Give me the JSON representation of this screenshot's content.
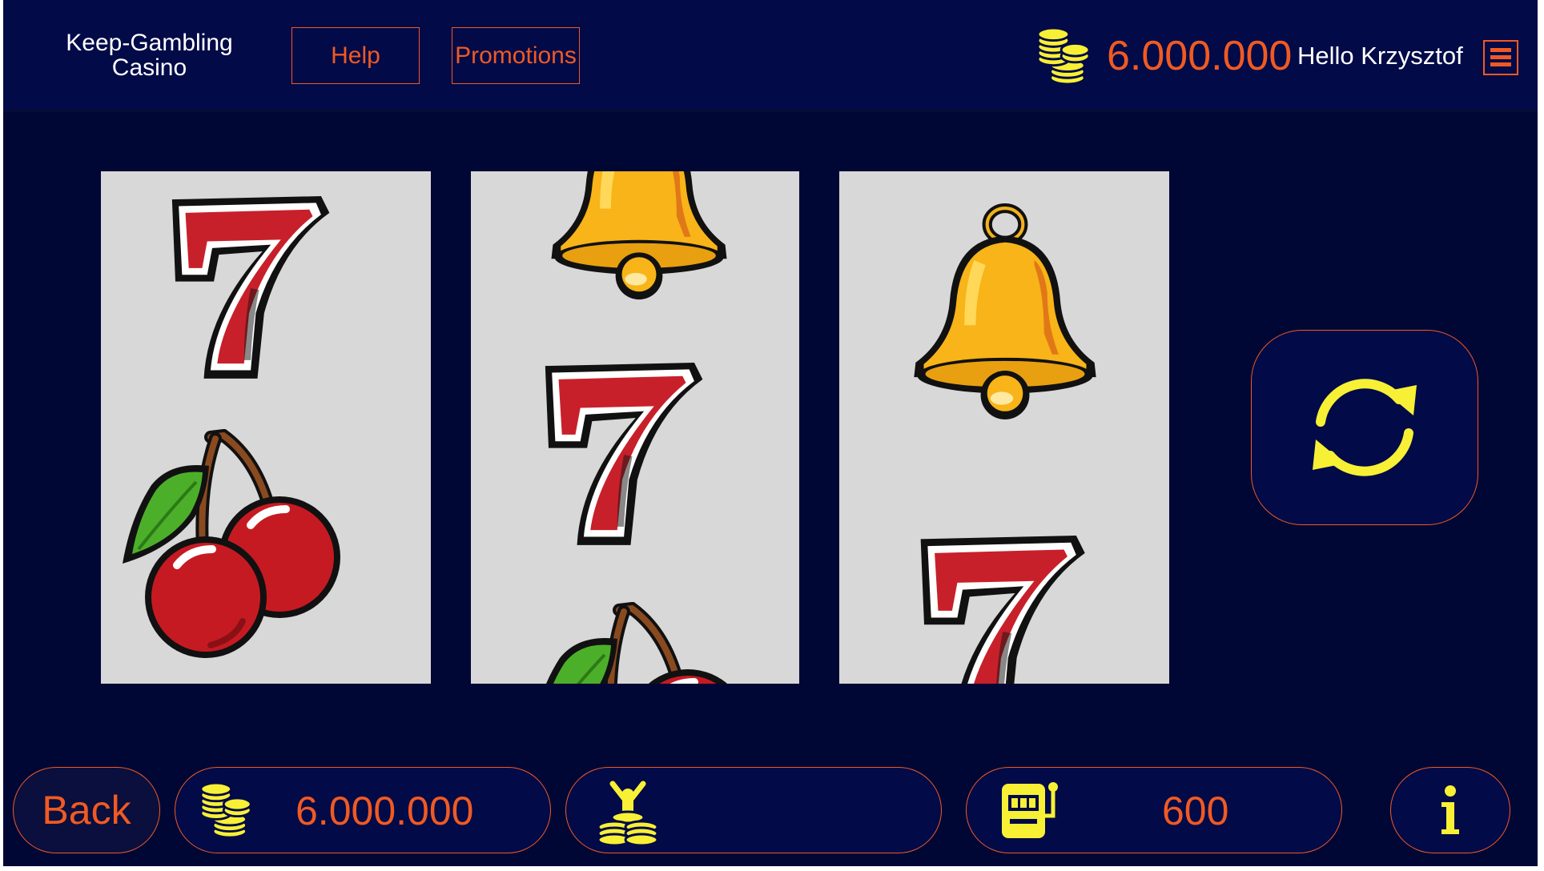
{
  "header": {
    "logo": "Keep-Gambling\nCasino",
    "logo_line1": "Keep-Gambling",
    "logo_line2": "Casino",
    "help_label": "Help",
    "promotions_label": "Promotions",
    "balance": "6.000.000",
    "greeting": "Hello Krzysztof",
    "coin_icon": "coin-stack-icon",
    "menu_icon": "hamburger-menu-icon"
  },
  "reels": [
    {
      "name": "reel-1",
      "symbols": [
        "seven",
        "cherry"
      ]
    },
    {
      "name": "reel-2",
      "symbols": [
        "bell",
        "seven",
        "cherry"
      ]
    },
    {
      "name": "reel-3",
      "symbols": [
        "bell",
        "seven"
      ]
    }
  ],
  "spin": {
    "icon": "refresh-icon"
  },
  "footer": {
    "back_label": "Back",
    "balance": "6.000.000",
    "win_icon": "winner-coins-icon",
    "bet": "600",
    "bet_icon": "slot-machine-icon",
    "info_icon": "info-icon"
  },
  "colors": {
    "background": "#010735",
    "header_bg": "#020a48",
    "accent": "#f05a22",
    "icon_yellow": "#f7f035",
    "reel_bg": "#d8d8d8",
    "seven_red": "#c8202a",
    "bell_gold": "#f8b418",
    "cherry_red": "#c61a22",
    "leaf_green": "#4caf2a"
  }
}
